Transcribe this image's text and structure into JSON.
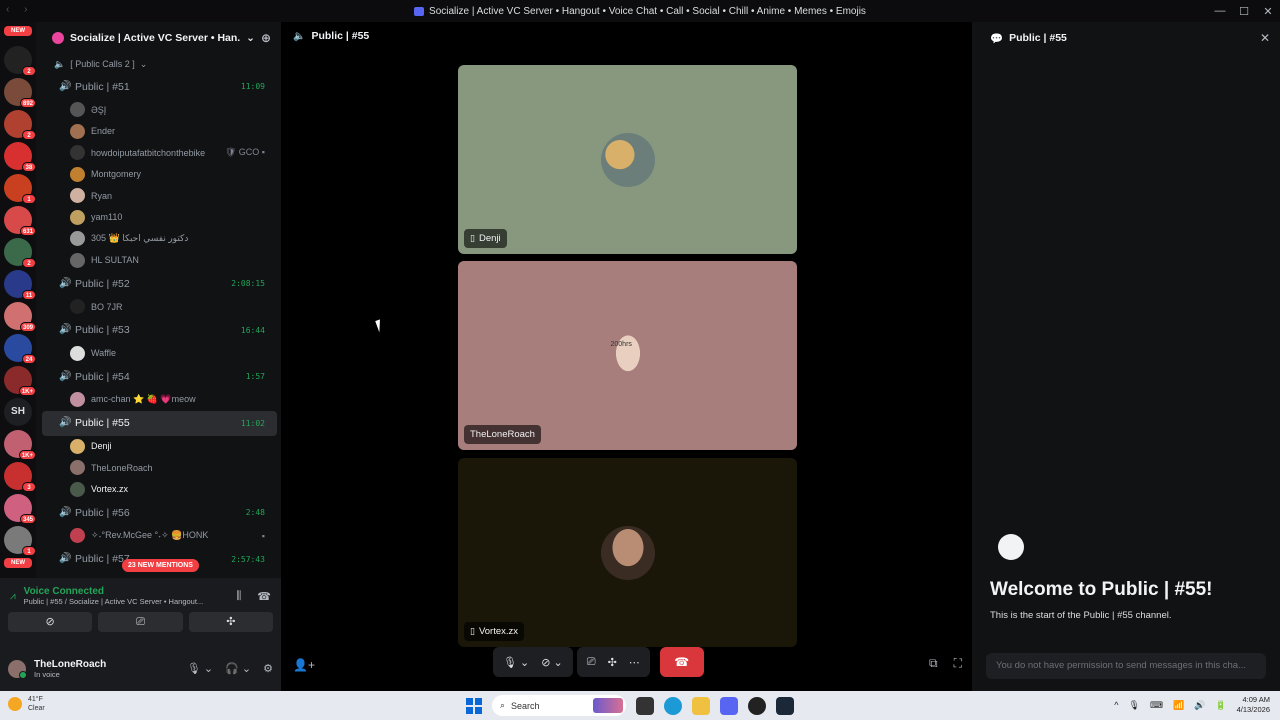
{
  "window": {
    "title": "Socialize | Active VC Server • Hangout • Voice Chat • Call • Social • Chill • Anime • Memes • Emojis",
    "nav_glyphs": "‹ ›",
    "controls": [
      "—",
      "☐",
      "✕"
    ]
  },
  "rail": {
    "new_top": "NEW",
    "new_bottom": "NEW",
    "sh_label": "SH",
    "servers": [
      {
        "badge": "2",
        "color": "#222"
      },
      {
        "badge": "892",
        "color": "#7a4a3a"
      },
      {
        "badge": "2",
        "color": "#b04030"
      },
      {
        "badge": "38",
        "color": "#d83030"
      },
      {
        "badge": "1",
        "color": "#c84020"
      },
      {
        "badge": "631",
        "color": "#d84a4a"
      },
      {
        "badge": "2",
        "color": "#3a6a4a"
      },
      {
        "badge": "11",
        "color": "#2a3a8a"
      },
      {
        "badge": "309",
        "color": "#d07070"
      },
      {
        "badge": "24",
        "color": "#2a4aa0"
      },
      {
        "badge": "1K+",
        "color": "#8a2a2a"
      },
      {
        "badge": "1K+",
        "color": "#c06070"
      },
      {
        "badge": "3",
        "color": "#c83030"
      },
      {
        "badge": "345",
        "color": "#d06080"
      },
      {
        "badge": "1",
        "color": "#7a7a7a"
      }
    ]
  },
  "guild": {
    "name": "Socialize | Active VC Server • Han...",
    "chevron": "⌄",
    "category": "[ Public Calls 2 ]",
    "mentions_pill": "23 NEW MENTIONS"
  },
  "channels": [
    {
      "name": "Public | #51",
      "timer": "11:09",
      "users": [
        {
          "name": "ƏŞĮ",
          "tail": "",
          "color": "#555",
          "bright": false
        },
        {
          "name": "Ender",
          "tail": "",
          "color": "#a07050",
          "bright": false
        },
        {
          "name": "howdoiputafatbitchonthebike",
          "tail": "🛡 GCO ▪",
          "color": "#333",
          "bright": false
        },
        {
          "name": "Montgomery",
          "tail": "",
          "color": "#c08030",
          "bright": false
        },
        {
          "name": "Ryan",
          "tail": "",
          "color": "#d0b0a0",
          "bright": false
        },
        {
          "name": "yam110",
          "tail": "",
          "color": "#c0a060",
          "bright": false
        },
        {
          "name": "دكتور نفسي احبكا 👑 305",
          "tail": "",
          "color": "#999",
          "bright": false
        },
        {
          "name": "HL SULTAN",
          "tail": "",
          "color": "#666",
          "bright": false
        }
      ]
    },
    {
      "name": "Public | #52",
      "timer": "2:08:15",
      "users": [
        {
          "name": "BO 7JR",
          "tail": "",
          "color": "#222",
          "bright": false
        }
      ]
    },
    {
      "name": "Public | #53",
      "timer": "16:44",
      "users": [
        {
          "name": "Waffle",
          "tail": "",
          "color": "#ddd",
          "bright": false
        }
      ]
    },
    {
      "name": "Public | #54",
      "timer": "1:57",
      "users": [
        {
          "name": "amc-chan ⭐ 🍓 💗meow",
          "tail": "",
          "color": "#c090a0",
          "bright": false
        }
      ]
    },
    {
      "name": "Public | #55",
      "timer": "11:02",
      "active": true,
      "users": [
        {
          "name": "Denji",
          "tail": "",
          "color": "#d9b06a",
          "bright": true
        },
        {
          "name": "TheLoneRoach",
          "tail": "",
          "color": "#8a6f6a",
          "bright": false
        },
        {
          "name": "Vortex.zx",
          "tail": "",
          "color": "#4a5a4a",
          "bright": true
        }
      ]
    },
    {
      "name": "Public | #56",
      "timer": "2:48",
      "users": [
        {
          "name": "✧˖°Rev.McGee °˖✧ 🍔HONK",
          "tail": "▪",
          "color": "#c04050",
          "bright": false
        }
      ]
    },
    {
      "name": "Public | #57",
      "timer": "2:57:43",
      "users": []
    }
  ],
  "voice_panel": {
    "status": "Voice Connected",
    "location": "Public | #55 / Socialize | Active VC Server • Hangout...",
    "signal_glyph": "⩘",
    "noise_glyph": "⫼",
    "disconnect_glyph": "☎",
    "buttons": [
      "⊘",
      "⎚",
      "✣"
    ]
  },
  "user_panel": {
    "name": "TheLoneRoach",
    "status": "In voice",
    "icons": [
      "🎙 ⌄",
      "🎧 ⌄",
      "⚙"
    ]
  },
  "stage": {
    "channel": "Public | #55",
    "tiles": [
      {
        "name": "Denji",
        "mobile": true,
        "speaking": true
      },
      {
        "name": "TheLoneRoach",
        "mobile": false,
        "speaking": false
      },
      {
        "name": "Vortex.zx",
        "mobile": true,
        "speaking": true
      }
    ],
    "roach_avatar_text": "200hrs",
    "controls": {
      "mic": "🎙 ⌄",
      "camera": "⊘ ⌄",
      "share": "⎚",
      "activities": "✣",
      "more": "⋯",
      "end": "☎"
    },
    "right_icons": [
      "⧉",
      "⛶"
    ],
    "invite_icon": "👤+"
  },
  "chat": {
    "title": "Public | #55",
    "close": "✕",
    "welcome_title": "Welcome to Public | #55!",
    "welcome_sub": "This is the start of the Public | #55 channel.",
    "input_placeholder": "You do not have permission to send messages in this cha..."
  },
  "taskbar": {
    "temp": "41°F",
    "condition": "Clear",
    "search_label": "Search",
    "time": "4:09 AM",
    "date": "4/13/2026",
    "tray": [
      "^",
      "🎙",
      "⌨",
      "📶",
      "🔊",
      "🔋"
    ]
  }
}
